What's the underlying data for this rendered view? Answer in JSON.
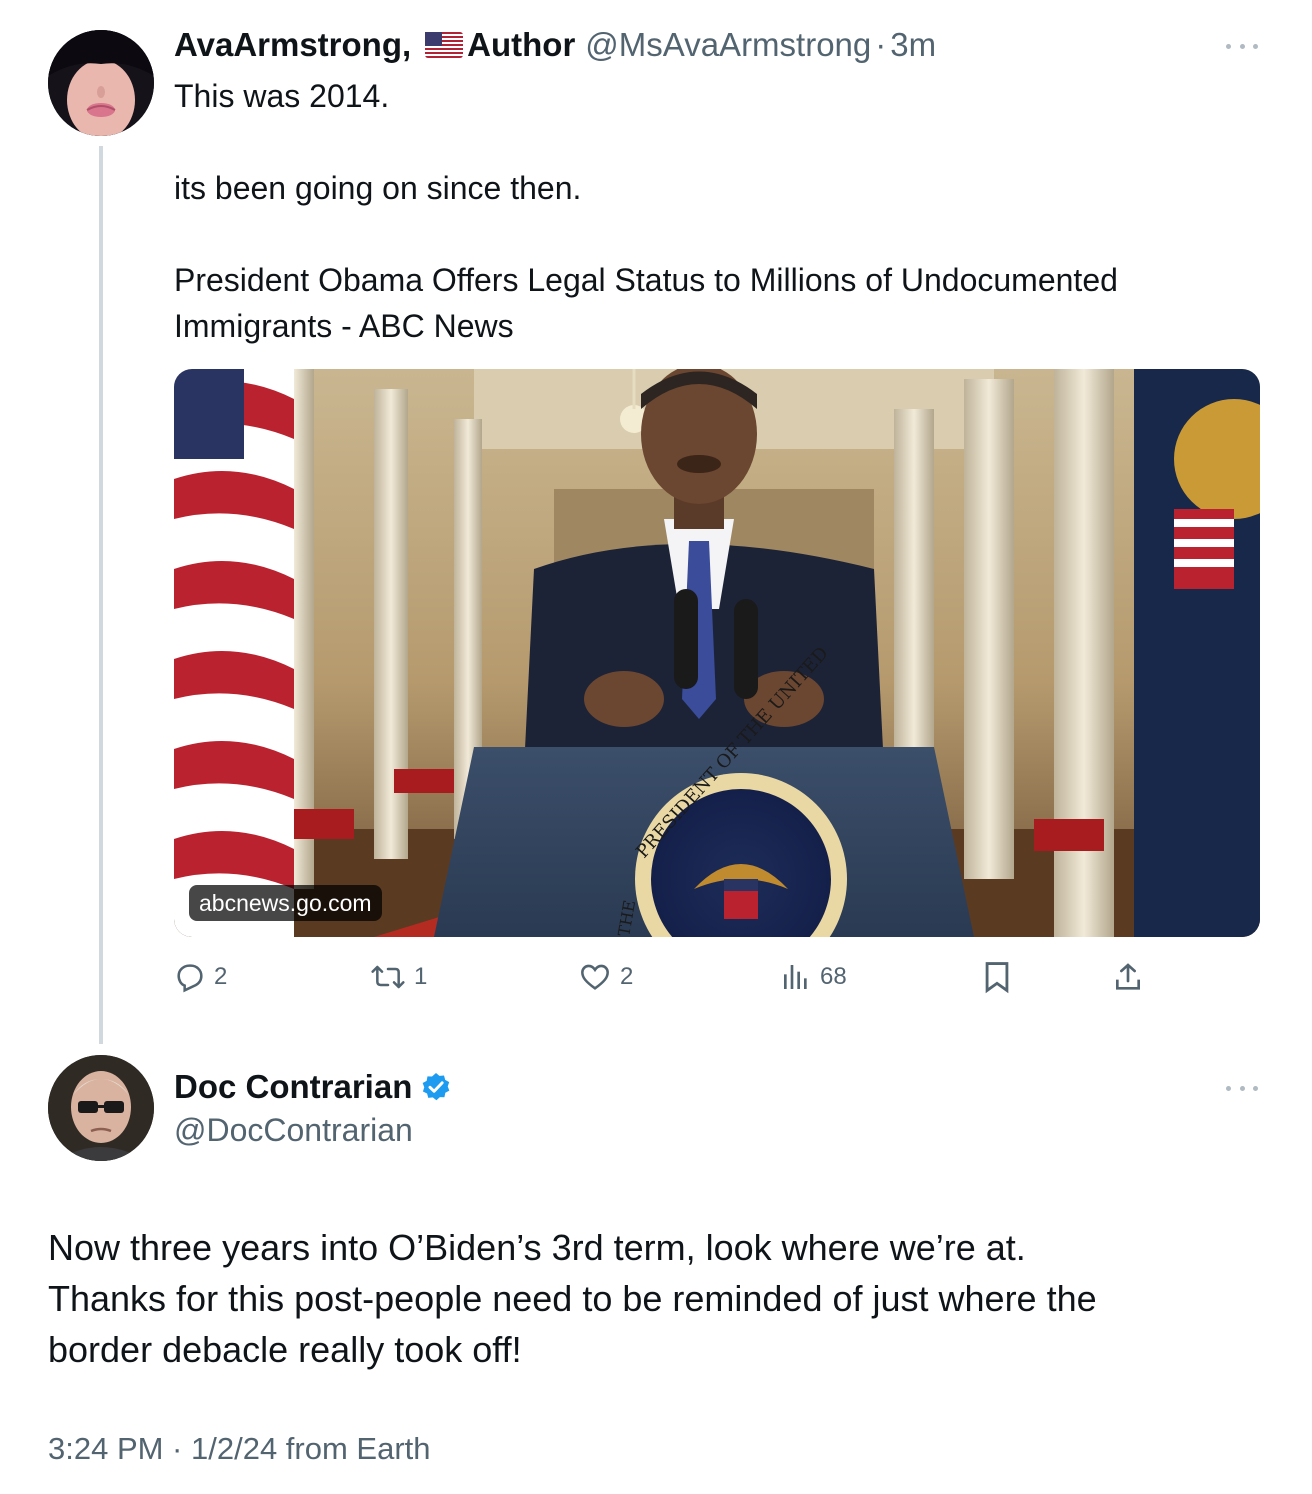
{
  "tweet1": {
    "display_name": "AvaArmstrong,",
    "flag_icon": "us-flag-emoji",
    "display_name_suffix": "Author",
    "handle": "@MsAvaArmstrong",
    "separator": "·",
    "time": "3m",
    "text_lines": [
      "This was 2014.",
      "its been going on since then.",
      "President Obama Offers Legal Status to Millions of Undocumented",
      "Immigrants - ABC News"
    ],
    "card": {
      "domain": "abcnews.go.com",
      "podium_seal_text": "PRESIDENT OF THE UNITED",
      "podium_seal_text_left": "THE"
    },
    "actions": {
      "replies": "2",
      "retweets": "1",
      "likes": "2",
      "views": "68"
    }
  },
  "tweet2": {
    "display_name": "Doc Contrarian",
    "verified_icon": "verified-badge-icon",
    "handle": "@DocContrarian",
    "text_lines": [
      "Now three years into O’Biden’s 3rd term, look where we’re at.",
      "Thanks for this post-people need to be reminded of just where the",
      "border debacle really took off!"
    ],
    "meta": "3:24 PM · 1/2/24 from Earth"
  },
  "colors": {
    "text_primary": "#0f1419",
    "text_secondary": "#536471",
    "verified_blue": "#1d9bf0",
    "thread_line": "#cfd9de"
  }
}
